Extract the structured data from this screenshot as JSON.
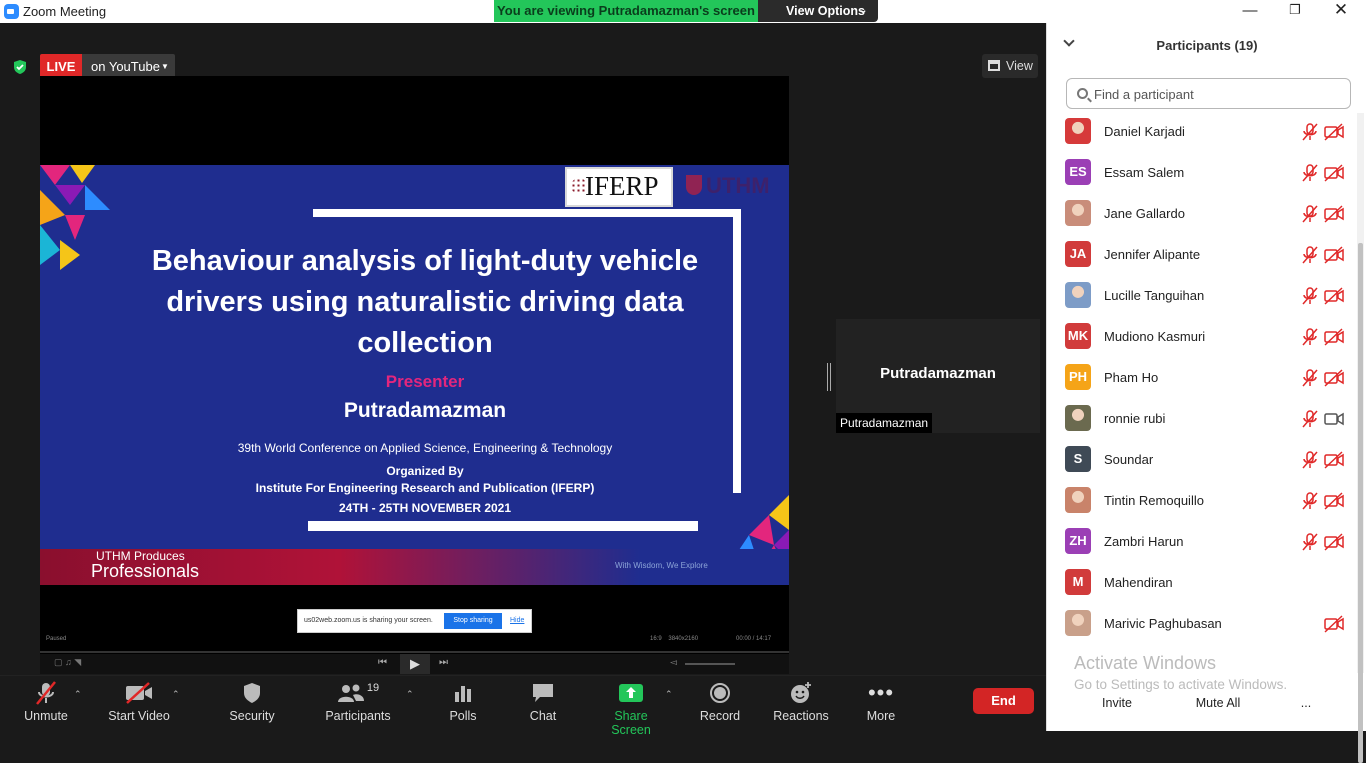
{
  "window": {
    "title": "Zoom Meeting"
  },
  "banner": {
    "viewing": "You are viewing Putradamazman's screen",
    "view_options": "View Options"
  },
  "topbar": {
    "live_label": "LIVE",
    "stream_target": "on YouTube",
    "view_label": "View"
  },
  "slide": {
    "logo_text": "IFERP",
    "logo2_text": "UTHM",
    "title": "Behaviour analysis of light-duty vehicle drivers using naturalistic driving data collection",
    "presenter_heading": "Presenter",
    "presenter_name": "Putradamazman",
    "conference": "39th World Conference on Applied Science, Engineering & Technology",
    "organized_by": "Organized By",
    "organizer": "Institute For Engineering Research and Publication (IFERP)",
    "dates": "24TH - 25TH NOVEMBER 2021",
    "footer_line1": "UTHM Produces",
    "footer_line2": "Professionals",
    "tagline": "With Wisdom, We Explore"
  },
  "sharing_bar": {
    "message": "us02web.zoom.us is sharing your screen.",
    "stop_label": "Stop sharing",
    "hide_label": "Hide"
  },
  "player": {
    "status": "Paused",
    "aspect": "16:9",
    "resolution": "3840x2160",
    "time": "00:00 / 14:17"
  },
  "thumbnail": {
    "big_name": "Putradamazman",
    "label": "Putradamazman"
  },
  "toolbar": {
    "unmute": "Unmute",
    "start_video": "Start Video",
    "security": "Security",
    "participants": "Participants",
    "participants_count": "19",
    "polls": "Polls",
    "chat": "Chat",
    "share_screen": "Share Screen",
    "record": "Record",
    "reactions": "Reactions",
    "more": "More",
    "end": "End"
  },
  "panel": {
    "title": "Participants (19)",
    "search_placeholder": "Find a participant",
    "participants": [
      {
        "name": "Daniel Karjadi",
        "initials": "",
        "color": "#d63a3a",
        "mic_muted": true,
        "cam_off": true
      },
      {
        "name": "Essam Salem",
        "initials": "ES",
        "color": "#9b3fb5",
        "mic_muted": true,
        "cam_off": true
      },
      {
        "name": "Jane Gallardo",
        "initials": "",
        "color": "#c98d7a",
        "mic_muted": true,
        "cam_off": true
      },
      {
        "name": "Jennifer Alipante",
        "initials": "JA",
        "color": "#d13b3b",
        "mic_muted": true,
        "cam_off": true
      },
      {
        "name": "Lucille Tanguihan",
        "initials": "",
        "color": "#7d9cc7",
        "mic_muted": true,
        "cam_off": true
      },
      {
        "name": "Mudiono Kasmuri",
        "initials": "MK",
        "color": "#d13b3b",
        "mic_muted": true,
        "cam_off": true
      },
      {
        "name": "Pham Ho",
        "initials": "PH",
        "color": "#f5a418",
        "mic_muted": true,
        "cam_off": true
      },
      {
        "name": "ronnie rubi",
        "initials": "",
        "color": "#6b6a4f",
        "mic_muted": true,
        "cam_off": false
      },
      {
        "name": "Soundar",
        "initials": "S",
        "color": "#3f4a56",
        "mic_muted": true,
        "cam_off": true
      },
      {
        "name": "Tintin Remoquillo",
        "initials": "",
        "color": "#c9836a",
        "mic_muted": true,
        "cam_off": true
      },
      {
        "name": "Zambri Harun",
        "initials": "ZH",
        "color": "#9b3fb5",
        "mic_muted": true,
        "cam_off": true
      },
      {
        "name": "Mahendiran",
        "initials": "M",
        "color": "#d13b3b",
        "mic_muted": false,
        "cam_off": false
      },
      {
        "name": "Marivic Paghubasan",
        "initials": "",
        "color": "#c9a08a",
        "mic_muted": false,
        "cam_off": true
      }
    ],
    "watermark_line1": "Activate Windows",
    "watermark_line2": "Go to Settings to activate Windows.",
    "invite": "Invite",
    "mute_all": "Mute All",
    "more": "..."
  },
  "colors": {
    "live_red": "#e02828",
    "share_green": "#23c65a",
    "end_red": "#d32525",
    "slide_blue": "#1f2d8f",
    "presenter_pink": "#e3267d"
  }
}
